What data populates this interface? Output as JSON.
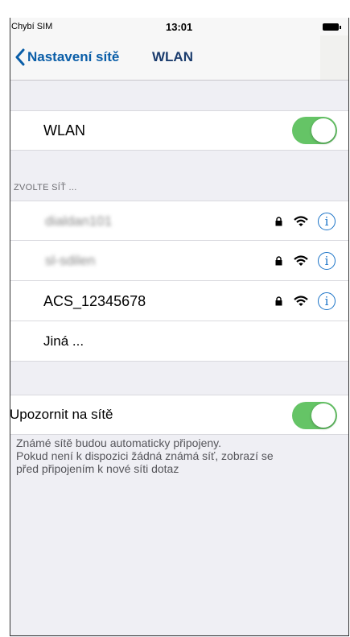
{
  "status_bar": {
    "carrier": "Chybí SIM",
    "time": "13:01"
  },
  "nav": {
    "back_label": "Nastavení sítě",
    "title": "WLAN"
  },
  "wlan": {
    "label": "WLAN",
    "enabled": true
  },
  "networks": {
    "header": "ZVOLTE SÍŤ ...",
    "items": [
      {
        "name": "dialdan101",
        "blurred": true,
        "secured": true
      },
      {
        "name": "sl-sdilen",
        "blurred": true,
        "secured": true
      },
      {
        "name": "ACS_12345678",
        "blurred": false,
        "secured": true
      }
    ],
    "other_label": "Jiná ..."
  },
  "notify": {
    "label": "Upozornit na sítě",
    "enabled": true
  },
  "footer": {
    "lines": [
      "Známé sítě budou automaticky připojeny.",
      "Pokud není k dispozici žádná známá síť, zobrazí se",
      "před připojením k nové síti dotaz"
    ]
  },
  "icons": {
    "lock": "lock-icon",
    "wifi": "wifi-icon",
    "info": "info-icon"
  },
  "colors": {
    "accent": "#0a5ea8",
    "toggle_on": "#65c466",
    "background": "#efeff4"
  }
}
